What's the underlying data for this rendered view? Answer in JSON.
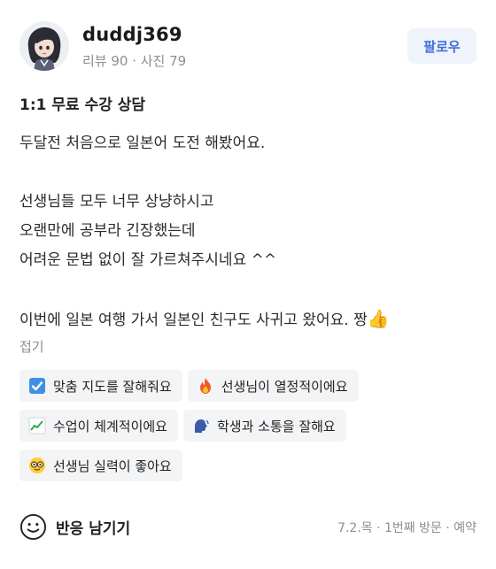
{
  "user": {
    "name": "duddj369",
    "meta": "리뷰 90 · 사진 79",
    "follow_label": "팔로우"
  },
  "review": {
    "title": "1:1 무료 수강 상담",
    "lines": [
      "두달전 처음으로 일본어 도전 해봤어요.",
      "",
      "선생님들 모두 너무 상냥하시고",
      "오랜만에 공부라 긴장했는데",
      "어려운 문법 없이 잘 가르쳐주시네요 ^^",
      "",
      "이번에 일본 여행 가서 일본인 친구도 사귀고 왔어요. 짱"
    ],
    "emoji_end": "👍",
    "fold_label": "접기"
  },
  "tags": [
    {
      "icon": "check-box-icon",
      "label": "맞춤 지도를 잘해줘요"
    },
    {
      "icon": "fire-icon",
      "label": "선생님이 열정적이에요"
    },
    {
      "icon": "chart-up-icon",
      "label": "수업이 체계적이에요"
    },
    {
      "icon": "speaking-head-icon",
      "label": "학생과 소통을 잘해요"
    },
    {
      "icon": "nerd-face-icon",
      "label": "선생님 실력이 좋아요"
    }
  ],
  "footer": {
    "react_label": "반응 남기기",
    "visit_info": "7.2.목 · 1번째 방문 · 예약"
  },
  "colors": {
    "accent": "#3f6fd8",
    "follow_bg": "#eef3fc",
    "tag_bg": "#f3f4f6",
    "muted": "#8a8f96"
  }
}
